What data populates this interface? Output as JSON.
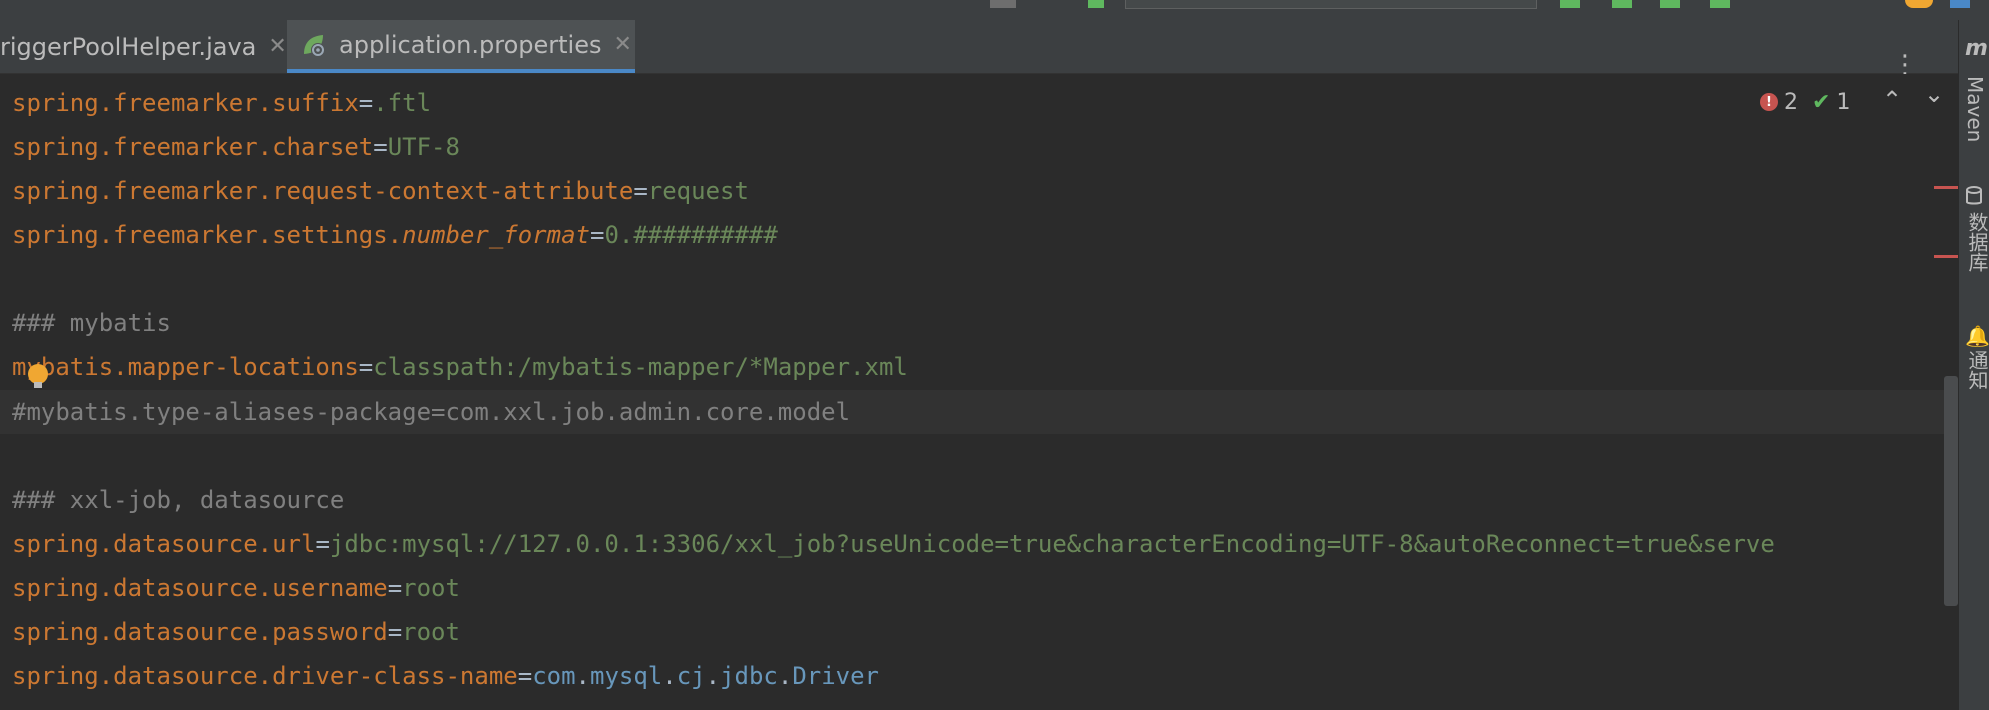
{
  "tabs": [
    {
      "label": "riggerPoolHelper.java",
      "close": "✕",
      "active": false
    },
    {
      "label": "application.properties",
      "close": "✕",
      "active": true
    }
  ],
  "inspection": {
    "errors": "2",
    "warnings": "1",
    "up": "⌃",
    "down": "⌄"
  },
  "right_toolbar": {
    "maven_label": "Maven",
    "database_label": "数据库",
    "notifications_label": "通知",
    "m_glyph": "m"
  },
  "kebab": "⋮",
  "editor": {
    "lines": [
      {
        "key": "spring.freemarker.suffix",
        "eq": "=",
        "value": ".ftl"
      },
      {
        "key": "spring.freemarker.charset",
        "eq": "=",
        "value": "UTF-8"
      },
      {
        "key": "spring.freemarker.request-context-attribute",
        "eq": "=",
        "value": "request"
      },
      {
        "key": "spring.freemarker.settings.",
        "key_italic": "number_format",
        "eq": "=",
        "value": "0.##########"
      },
      {
        "comment": "### mybatis"
      },
      {
        "key": "mybatis.mapper-locations",
        "eq": "=",
        "value": "classpath:/mybatis-mapper/*Mapper.xml"
      },
      {
        "comment": "#mybatis.type-aliases-package=com.xxl.job.admin.core.model"
      },
      {
        "comment": "### xxl-job, datasource"
      },
      {
        "key": "spring.datasource.url",
        "eq": "=",
        "value": "jdbc:mysql://127.0.0.1:3306/xxl_job?useUnicode=true&characterEncoding=UTF-8&autoReconnect=true&serve"
      },
      {
        "key": "spring.datasource.username",
        "eq": "=",
        "value": "root"
      },
      {
        "key": "spring.datasource.password",
        "eq": "=",
        "value": "root"
      },
      {
        "key": "spring.datasource.driver-class-name",
        "eq": "=",
        "value_parts": [
          "com",
          ".",
          "mysql",
          ".",
          "cj",
          ".",
          "jdbc",
          ".",
          "Driver"
        ]
      }
    ]
  }
}
